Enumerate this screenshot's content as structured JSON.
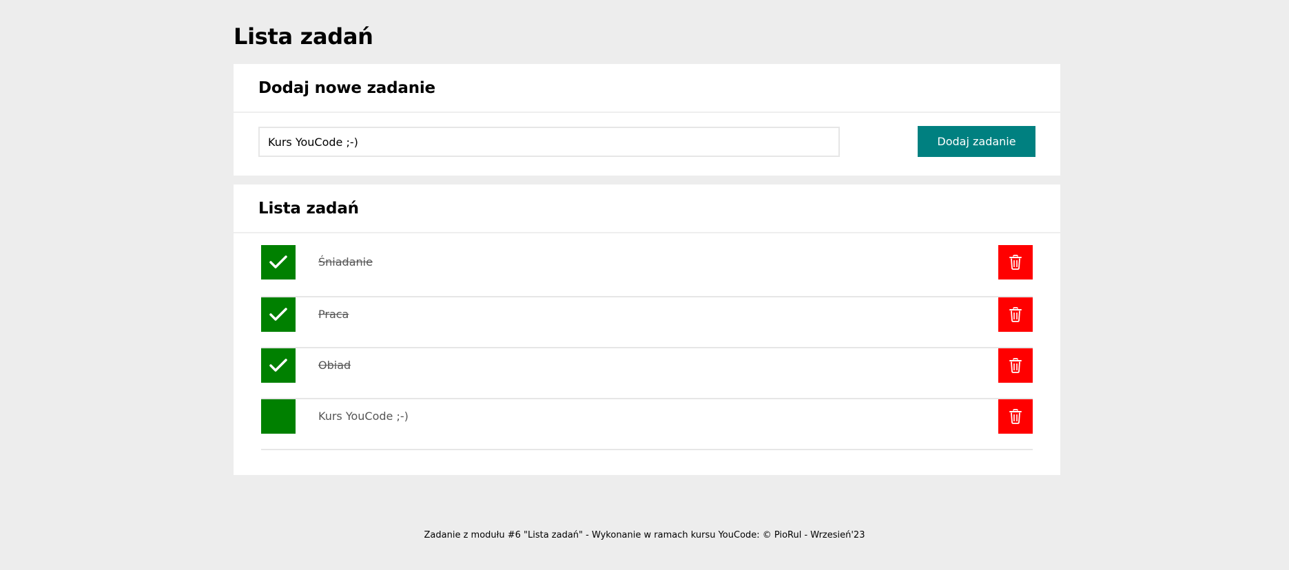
{
  "page": {
    "title": "Lista zadań"
  },
  "add_section": {
    "heading": "Dodaj nowe zadanie",
    "input_value": "Kurs YouCode ;-)",
    "button_label": "Dodaj zadanie"
  },
  "list_section": {
    "heading": "Lista zadań",
    "tasks": [
      {
        "text": "Śniadanie",
        "done": true
      },
      {
        "text": "Praca",
        "done": true
      },
      {
        "text": "Obiad",
        "done": true
      },
      {
        "text": "Kurs YouCode ;-)",
        "done": false
      }
    ]
  },
  "icons": {
    "toggle": "checkmark-icon",
    "delete": "trash-icon"
  },
  "colors": {
    "background": "#ededed",
    "primary_button": "#008080",
    "done_toggle": "#008000",
    "delete": "#ff0000"
  },
  "footer": {
    "text": "Zadanie z modułu #6 \"Lista zadań\" - Wykonanie w ramach kursu YouCode: © PioRul - Wrzesień'23"
  }
}
